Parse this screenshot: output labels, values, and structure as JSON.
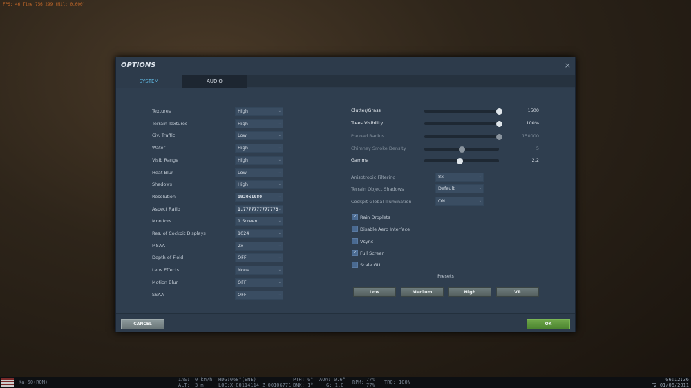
{
  "hud": {
    "fps": "FPS: 46 Time 756.299 (Mil: 0.000)"
  },
  "dialog": {
    "title": "OPTIONS",
    "tabs": [
      "SYSTEM",
      "AUDIO"
    ],
    "close": "×"
  },
  "left": [
    {
      "label": "Textures",
      "value": "High"
    },
    {
      "label": "Terrain Textures",
      "value": "High"
    },
    {
      "label": "Civ. Traffic",
      "value": "Low"
    },
    {
      "label": "Water",
      "value": "High"
    },
    {
      "label": "Visib Range",
      "value": "High"
    },
    {
      "label": "Heat Blur",
      "value": "Low"
    },
    {
      "label": "Shadows",
      "value": "High"
    },
    {
      "label": "Resolution",
      "value": "1920x1080"
    },
    {
      "label": "Aspect Ratio",
      "value": "1.7777777777778"
    },
    {
      "label": "Monitors",
      "value": "1 Screen"
    },
    {
      "label": "Res. of Cockpit Displays",
      "value": "1024"
    },
    {
      "label": "MSAA",
      "value": "2x"
    },
    {
      "label": "Depth of Field",
      "value": "OFF"
    },
    {
      "label": "Lens Effects",
      "value": "None"
    },
    {
      "label": "Motion Blur",
      "value": "OFF"
    },
    {
      "label": "SSAA",
      "value": "OFF"
    }
  ],
  "sliders": [
    {
      "label": "Clutter/Grass",
      "value": "1500",
      "fraction": 1.0,
      "enabled": true
    },
    {
      "label": "Trees Visibility",
      "value": "100%",
      "fraction": 1.0,
      "enabled": true
    },
    {
      "label": "Preload Radius",
      "value": "150000",
      "fraction": 1.0,
      "enabled": false
    },
    {
      "label": "Chimney Smoke Density",
      "value": "5",
      "fraction": 0.5,
      "enabled": false
    },
    {
      "label": "Gamma",
      "value": "2.2",
      "fraction": 0.48,
      "enabled": true
    }
  ],
  "right_selects": [
    {
      "label": "Anisotropic Filtering",
      "value": "8x"
    },
    {
      "label": "Terrain Object Shadows",
      "value": "Default"
    },
    {
      "label": "Cockpit Global Illumination",
      "value": "ON"
    }
  ],
  "checkboxes": [
    {
      "label": "Rain Droplets",
      "checked": true
    },
    {
      "label": "Disable Aero Interface",
      "checked": false
    },
    {
      "label": "Vsync",
      "checked": false
    },
    {
      "label": "Full Screen",
      "checked": true
    },
    {
      "label": "Scale GUI",
      "checked": false
    }
  ],
  "presets": {
    "label": "Presets",
    "buttons": [
      "Low",
      "Medium",
      "High",
      "VR"
    ]
  },
  "footer": {
    "cancel": "CANCEL",
    "ok": "OK"
  },
  "status": {
    "aircraft": "Ka-50(ROM)",
    "ias_label": "IAS:",
    "ias": "0 km/h",
    "alt_label": "ALT:",
    "alt": "3 m",
    "hdg": "HDG:068°(ENE)",
    "loc": "LOC:X-00114114 Z-00106771",
    "pth": "PTH: 0°",
    "bnk": "BNK: 1°",
    "aoa": "AOA: 0.6°",
    "g": "G: 1.0",
    "rpm_label": "RPM:",
    "rpm1": "77%",
    "rpm2": "77%",
    "trq": "TRQ: 100%",
    "time": "06:12:36",
    "date": "F2 01/06/2011"
  }
}
